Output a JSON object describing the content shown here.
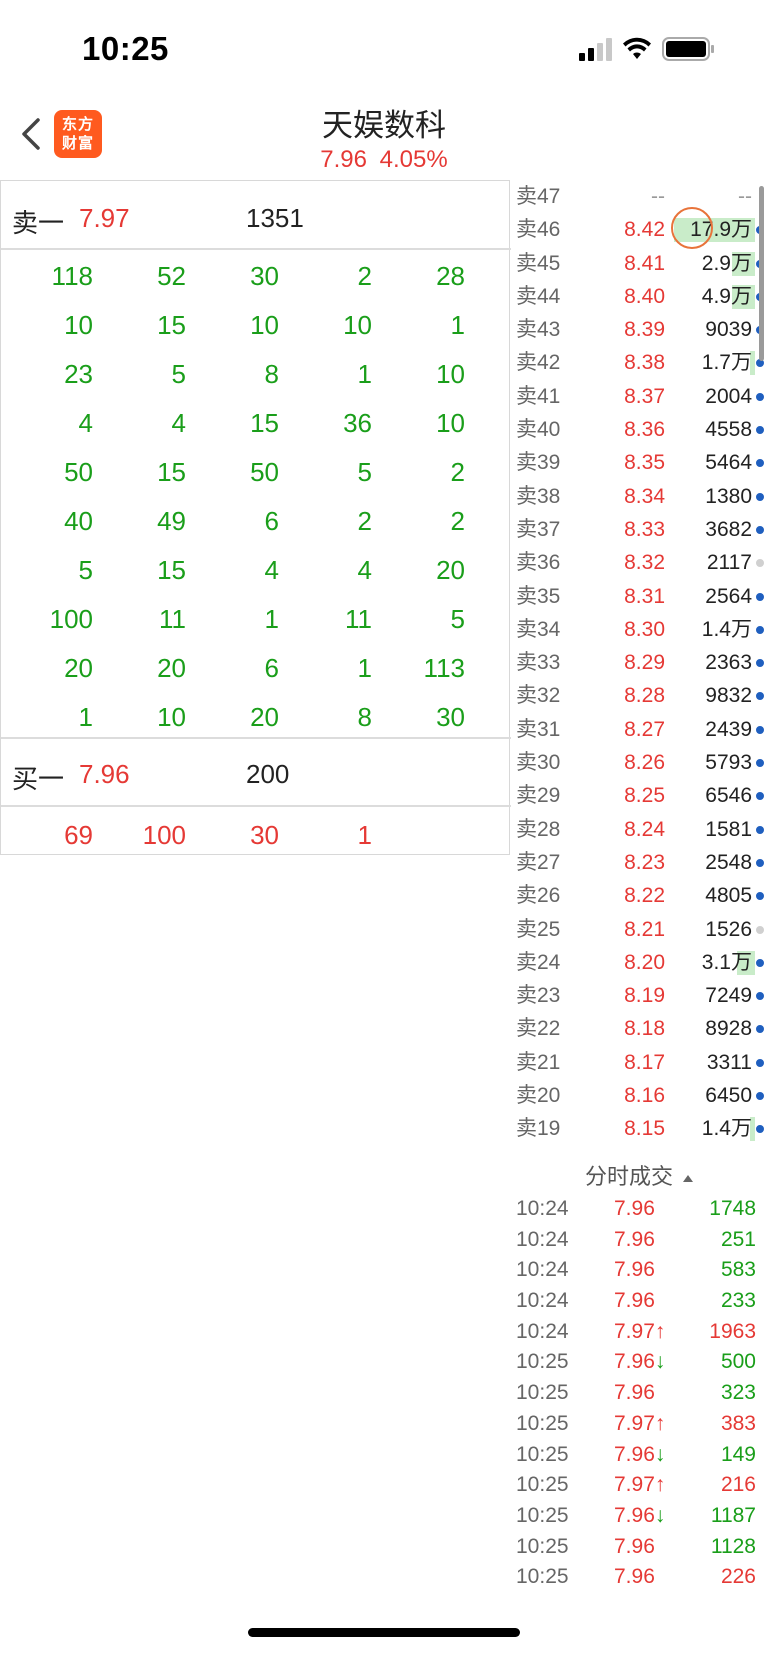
{
  "status_bar": {
    "time": "10:25"
  },
  "header": {
    "logo_line1": "东方",
    "logo_line2": "财富",
    "stock_name": "天娱数科",
    "price": "7.96",
    "change_pct": "4.05%"
  },
  "left": {
    "sell": {
      "label": "卖一",
      "price": "7.97",
      "volume": "1351"
    },
    "sell_queue": [
      [
        "118",
        "52",
        "30",
        "2",
        "28"
      ],
      [
        "10",
        "15",
        "10",
        "10",
        "1"
      ],
      [
        "23",
        "5",
        "8",
        "1",
        "10"
      ],
      [
        "4",
        "4",
        "15",
        "36",
        "10"
      ],
      [
        "50",
        "15",
        "50",
        "5",
        "2"
      ],
      [
        "40",
        "49",
        "6",
        "2",
        "2"
      ],
      [
        "5",
        "15",
        "4",
        "4",
        "20"
      ],
      [
        "100",
        "11",
        "1",
        "11",
        "5"
      ],
      [
        "20",
        "20",
        "6",
        "1",
        "113"
      ],
      [
        "1",
        "10",
        "20",
        "8",
        "30"
      ]
    ],
    "buy": {
      "label": "买一",
      "price": "7.96",
      "volume": "200"
    },
    "buy_queue": [
      [
        "69",
        "100",
        "30",
        "1"
      ]
    ]
  },
  "order_book": [
    {
      "label": "卖47",
      "price": "--",
      "volume": "--",
      "bar": 0,
      "dot": "none",
      "empty": true
    },
    {
      "label": "卖46",
      "price": "8.42",
      "volume": "17.9万",
      "bar": 0.9,
      "dot": "blue"
    },
    {
      "label": "卖45",
      "price": "8.41",
      "volume": "2.9万",
      "bar": 0.25,
      "dot": "blue"
    },
    {
      "label": "卖44",
      "price": "8.40",
      "volume": "4.9万",
      "bar": 0.25,
      "dot": "blue"
    },
    {
      "label": "卖43",
      "price": "8.39",
      "volume": "9039",
      "bar": 0,
      "dot": "blue"
    },
    {
      "label": "卖42",
      "price": "8.38",
      "volume": "1.7万",
      "bar": 0.05,
      "dot": "blue"
    },
    {
      "label": "卖41",
      "price": "8.37",
      "volume": "2004",
      "bar": 0,
      "dot": "blue"
    },
    {
      "label": "卖40",
      "price": "8.36",
      "volume": "4558",
      "bar": 0,
      "dot": "blue"
    },
    {
      "label": "卖39",
      "price": "8.35",
      "volume": "5464",
      "bar": 0,
      "dot": "blue"
    },
    {
      "label": "卖38",
      "price": "8.34",
      "volume": "1380",
      "bar": 0,
      "dot": "blue"
    },
    {
      "label": "卖37",
      "price": "8.33",
      "volume": "3682",
      "bar": 0,
      "dot": "blue"
    },
    {
      "label": "卖36",
      "price": "8.32",
      "volume": "2117",
      "bar": 0,
      "dot": "grey"
    },
    {
      "label": "卖35",
      "price": "8.31",
      "volume": "2564",
      "bar": 0,
      "dot": "blue"
    },
    {
      "label": "卖34",
      "price": "8.30",
      "volume": "1.4万",
      "bar": 0,
      "dot": "blue"
    },
    {
      "label": "卖33",
      "price": "8.29",
      "volume": "2363",
      "bar": 0,
      "dot": "blue"
    },
    {
      "label": "卖32",
      "price": "8.28",
      "volume": "9832",
      "bar": 0,
      "dot": "blue"
    },
    {
      "label": "卖31",
      "price": "8.27",
      "volume": "2439",
      "bar": 0,
      "dot": "blue"
    },
    {
      "label": "卖30",
      "price": "8.26",
      "volume": "5793",
      "bar": 0,
      "dot": "blue"
    },
    {
      "label": "卖29",
      "price": "8.25",
      "volume": "6546",
      "bar": 0,
      "dot": "blue"
    },
    {
      "label": "卖28",
      "price": "8.24",
      "volume": "1581",
      "bar": 0,
      "dot": "blue"
    },
    {
      "label": "卖27",
      "price": "8.23",
      "volume": "2548",
      "bar": 0,
      "dot": "blue"
    },
    {
      "label": "卖26",
      "price": "8.22",
      "volume": "4805",
      "bar": 0,
      "dot": "blue"
    },
    {
      "label": "卖25",
      "price": "8.21",
      "volume": "1526",
      "bar": 0,
      "dot": "grey"
    },
    {
      "label": "卖24",
      "price": "8.20",
      "volume": "3.1万",
      "bar": 0.2,
      "dot": "blue"
    },
    {
      "label": "卖23",
      "price": "8.19",
      "volume": "7249",
      "bar": 0,
      "dot": "blue"
    },
    {
      "label": "卖22",
      "price": "8.18",
      "volume": "8928",
      "bar": 0,
      "dot": "blue"
    },
    {
      "label": "卖21",
      "price": "8.17",
      "volume": "3311",
      "bar": 0,
      "dot": "blue"
    },
    {
      "label": "卖20",
      "price": "8.16",
      "volume": "6450",
      "bar": 0,
      "dot": "blue"
    },
    {
      "label": "卖19",
      "price": "8.15",
      "volume": "1.4万",
      "bar": 0.05,
      "dot": "blue"
    }
  ],
  "ticks": {
    "title": "分时成交",
    "rows": [
      {
        "time": "10:24",
        "price": "7.96",
        "arrow": "",
        "volume": "1748",
        "side": "sell"
      },
      {
        "time": "10:24",
        "price": "7.96",
        "arrow": "",
        "volume": "251",
        "side": "sell"
      },
      {
        "time": "10:24",
        "price": "7.96",
        "arrow": "",
        "volume": "583",
        "side": "sell"
      },
      {
        "time": "10:24",
        "price": "7.96",
        "arrow": "",
        "volume": "233",
        "side": "sell"
      },
      {
        "time": "10:24",
        "price": "7.97",
        "arrow": "↑",
        "volume": "1963",
        "side": "buy"
      },
      {
        "time": "10:25",
        "price": "7.96",
        "arrow": "↓",
        "volume": "500",
        "side": "sell"
      },
      {
        "time": "10:25",
        "price": "7.96",
        "arrow": "",
        "volume": "323",
        "side": "sell"
      },
      {
        "time": "10:25",
        "price": "7.97",
        "arrow": "↑",
        "volume": "383",
        "side": "buy"
      },
      {
        "time": "10:25",
        "price": "7.96",
        "arrow": "↓",
        "volume": "149",
        "side": "sell"
      },
      {
        "time": "10:25",
        "price": "7.97",
        "arrow": "↑",
        "volume": "216",
        "side": "buy"
      },
      {
        "time": "10:25",
        "price": "7.96",
        "arrow": "↓",
        "volume": "1187",
        "side": "sell"
      },
      {
        "time": "10:25",
        "price": "7.96",
        "arrow": "",
        "volume": "1128",
        "side": "sell"
      },
      {
        "time": "10:25",
        "price": "7.96",
        "arrow": "",
        "volume": "226",
        "side": "buy"
      }
    ]
  },
  "colors": {
    "up": "#e53935",
    "down": "#1a9e1a",
    "brand": "#ff5a1f",
    "bar": "#c9ecc9"
  }
}
